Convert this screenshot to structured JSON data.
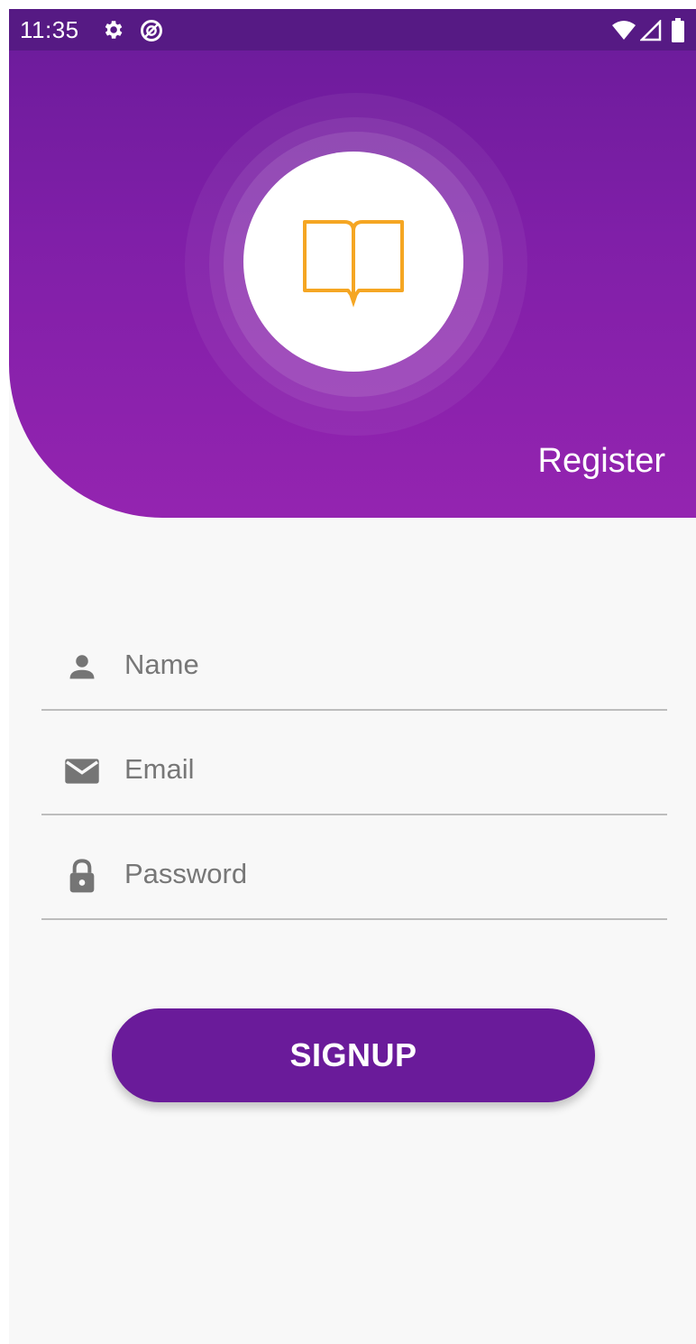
{
  "status_bar": {
    "time": "11:35",
    "left_icons": [
      "settings-icon",
      "data-saver-icon"
    ],
    "right_icons": [
      "wifi-icon",
      "signal-icon",
      "battery-icon"
    ]
  },
  "header": {
    "logo_icon": "open-book-icon",
    "title": "Register",
    "accent_color": "#f5a623",
    "background_color": "#8a1fab"
  },
  "form": {
    "name": {
      "placeholder": "Name",
      "value": "",
      "icon": "person-icon"
    },
    "email": {
      "placeholder": "Email",
      "value": "",
      "icon": "mail-icon"
    },
    "password": {
      "placeholder": "Password",
      "value": "",
      "icon": "lock-icon"
    }
  },
  "signup_button": {
    "label": "SIGNUP",
    "color": "#6a1b9a"
  }
}
